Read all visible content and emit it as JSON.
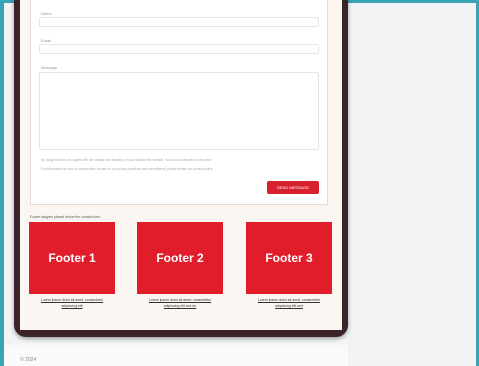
{
  "form": {
    "name_label": "Name",
    "email_label": "Email",
    "message_label": "Message",
    "fine_print_1": "By using this form you agree with the storage and handling of your data by this website. You can unsubscribe at any time.",
    "fine_print_2": "For information on how to unsubscribe, as well as our privacy practices and commitment, please review our privacy policy.",
    "submit_label": "SEND MESSAGE"
  },
  "footer_section": {
    "caption": "Footer widgets placed below the contact form",
    "boxes": [
      {
        "label": "Footer 1",
        "link_line1": "Lorem ipsum dolor sit amet, consectetur",
        "link_line2": "adipiscing elit"
      },
      {
        "label": "Footer 2",
        "link_line1": "Lorem ipsum dolor sit amet, consectetur",
        "link_line2": "adipiscing elit sed do"
      },
      {
        "label": "Footer 3",
        "link_line1": "Lorem ipsum dolor sit amet, consectetur",
        "link_line2": "adipiscing elit sed"
      }
    ]
  },
  "page_footer": {
    "text": "© 2024"
  },
  "colors": {
    "accent": "#e21d2b",
    "frame": "#3a2429",
    "teal": "#3aa3b5"
  }
}
